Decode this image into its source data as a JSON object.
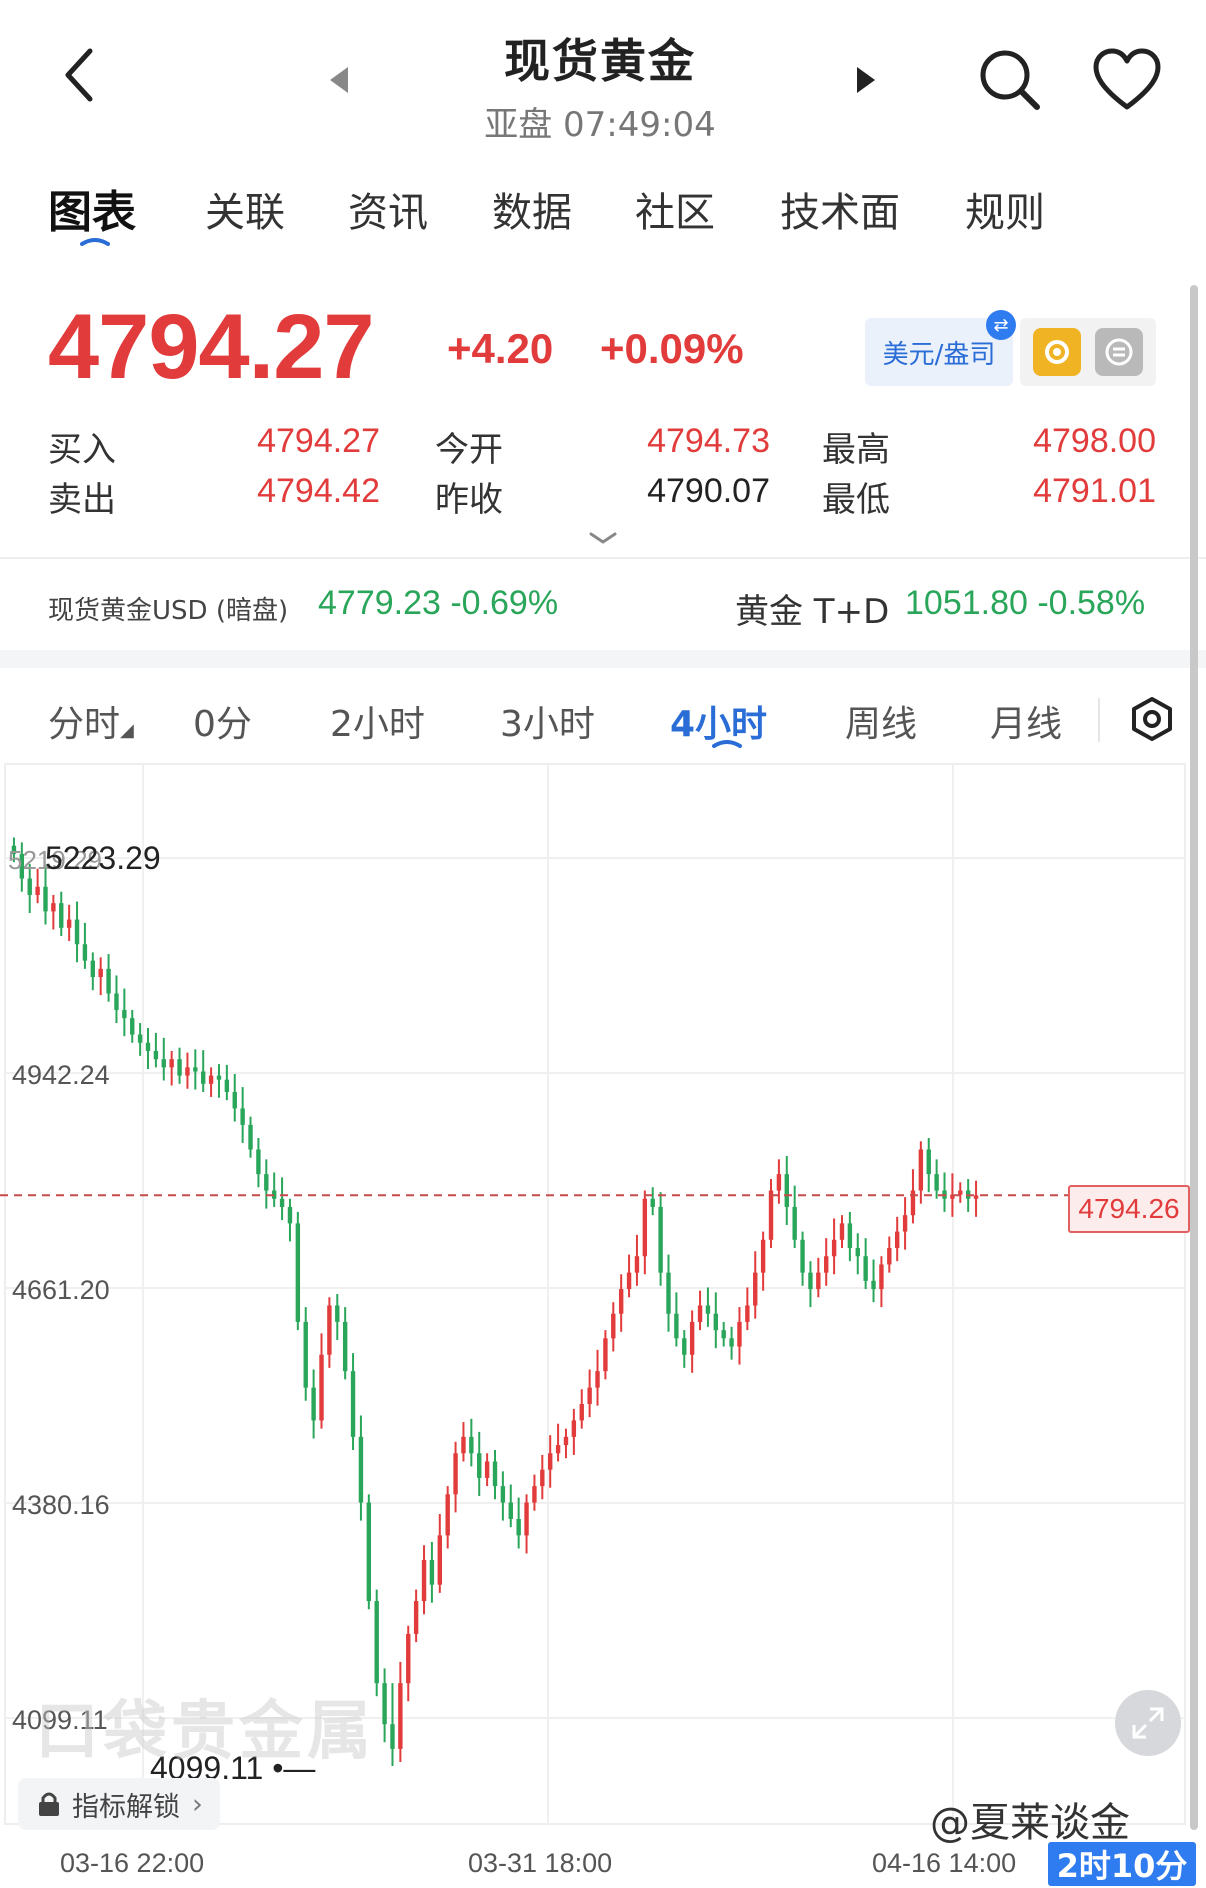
{
  "header": {
    "title": "现货黄金",
    "subtitle": "亚盘 07:49:04"
  },
  "tabs": [
    {
      "label": "图表",
      "active": true
    },
    {
      "label": "关联"
    },
    {
      "label": "资讯"
    },
    {
      "label": "数据"
    },
    {
      "label": "社区"
    },
    {
      "label": "技术面"
    },
    {
      "label": "规则"
    }
  ],
  "price": {
    "last": "4794.27",
    "change": "+4.20",
    "change_pct": "+0.09%",
    "currency_button": "美元/盎司"
  },
  "quote": {
    "buy_label": "买入",
    "buy": "4794.27",
    "sell_label": "卖出",
    "sell": "4794.42",
    "open_label": "今开",
    "open": "4794.73",
    "prev_close_label": "昨收",
    "prev_close": "4790.07",
    "high_label": "最高",
    "high": "4798.00",
    "low_label": "最低",
    "low": "4791.01"
  },
  "related": {
    "label1": "现货黄金USD (暗盘)",
    "value1": "4779.23 -0.69%",
    "label2": "黄金 T+D",
    "value2": "1051.80 -0.58%"
  },
  "periods": [
    {
      "label": "分时"
    },
    {
      "label": "0分"
    },
    {
      "label": "2小时"
    },
    {
      "label": "3小时"
    },
    {
      "label": "4小时",
      "active": true
    },
    {
      "label": "周线"
    },
    {
      "label": "月线"
    }
  ],
  "colors": {
    "up": "#e23b3b",
    "down": "#2aa65a",
    "accent": "#2b6dd6"
  },
  "chart_data": {
    "type": "candlestick",
    "title": "",
    "y_ticks": [
      "4942.24",
      "4661.20",
      "4380.16",
      "4099.11"
    ],
    "x_ticks": [
      "03-16 22:00",
      "03-31 18:00",
      "04-16 14:00"
    ],
    "y_range": [
      4099.11,
      5223.29
    ],
    "max_label": "5223.29",
    "max_label_ghost": "5219.29",
    "min_label": "4099.11",
    "current_price": "4794.26",
    "watermark": "口袋贵金属",
    "close_series": [
      5210,
      5180,
      5160,
      5170,
      5140,
      5150,
      5120,
      5130,
      5100,
      5080,
      5060,
      5070,
      5040,
      5020,
      5010,
      4990,
      4980,
      4970,
      4960,
      4950,
      4960,
      4940,
      4950,
      4945,
      4930,
      4940,
      4935,
      4920,
      4900,
      4880,
      4850,
      4820,
      4800,
      4790,
      4780,
      4760,
      4640,
      4560,
      4520,
      4600,
      4660,
      4640,
      4580,
      4500,
      4420,
      4300,
      4200,
      4150,
      4120,
      4200,
      4260,
      4300,
      4350,
      4320,
      4380,
      4430,
      4480,
      4500,
      4480,
      4450,
      4470,
      4440,
      4420,
      4400,
      4380,
      4420,
      4440,
      4460,
      4480,
      4490,
      4500,
      4520,
      4540,
      4560,
      4580,
      4620,
      4650,
      4680,
      4700,
      4720,
      4790,
      4780,
      4700,
      4650,
      4620,
      4600,
      4640,
      4660,
      4650,
      4630,
      4620,
      4610,
      4640,
      4660,
      4700,
      4740,
      4800,
      4820,
      4780,
      4740,
      4700,
      4680,
      4700,
      4720,
      4740,
      4760,
      4730,
      4720,
      4690,
      4680,
      4710,
      4730,
      4750,
      4770,
      4800,
      4850,
      4820,
      4800,
      4790,
      4795,
      4800,
      4790,
      4794
    ]
  },
  "unlock_label": "指标解锁",
  "author": "@夏莱谈金",
  "countdown": "2时10分"
}
